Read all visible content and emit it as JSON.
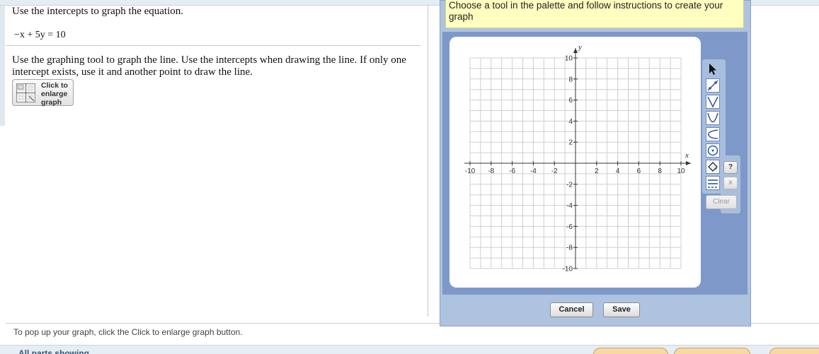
{
  "question": {
    "instruction": "Use the intercepts to graph the equation.",
    "equation": "−x + 5y = 10",
    "graph_instruction": "Use the graphing tool to graph the line. Use the intercepts when drawing the line. If only one intercept exists, use it and another point to draw the line.",
    "enlarge_button_label": "Click to enlarge graph"
  },
  "footer": {
    "hint": "To pop up your graph, click the Click to enlarge graph button.",
    "parts_showing": "All parts showing"
  },
  "graph_tool": {
    "tooltip": "Choose a tool in the palette and follow instructions to create your graph",
    "axis_x_label": "x",
    "axis_y_label": "y",
    "x_ticks": [
      "-10",
      "-8",
      "-6",
      "-4",
      "-2",
      "2",
      "4",
      "6",
      "8",
      "10"
    ],
    "y_ticks": [
      "10",
      "8",
      "6",
      "4",
      "2",
      "-2",
      "-4",
      "-6",
      "-8",
      "-10"
    ],
    "range": {
      "xmin": -10,
      "xmax": 10,
      "ymin": -10,
      "ymax": 10
    },
    "help_label": "?",
    "x_label": "x",
    "clear_label": "Clear",
    "cancel_label": "Cancel",
    "save_label": "Save",
    "tools": [
      "pointer-icon",
      "line-tool-icon",
      "absolute-value-icon",
      "parabola-icon",
      "curve-icon",
      "circle-icon",
      "fill-icon",
      "dashed-line-icon"
    ]
  }
}
